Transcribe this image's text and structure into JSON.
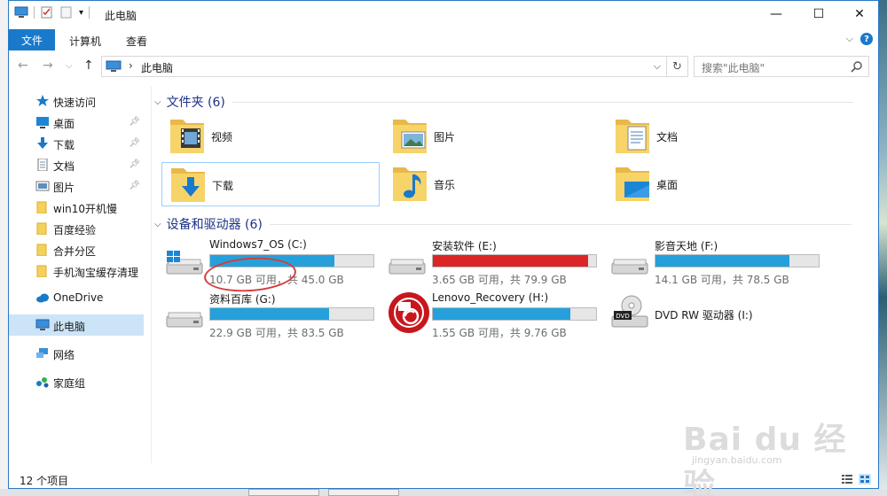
{
  "window": {
    "title": "此电脑",
    "minimize": "—",
    "maximize": "☐",
    "close": "✕"
  },
  "ribbon": {
    "file_tab": "文件",
    "tabs": [
      "计算机",
      "查看"
    ]
  },
  "address": {
    "path": "此电脑",
    "chevron": "›",
    "dropdown": "⌵",
    "refresh": "↻"
  },
  "search": {
    "placeholder": "搜索\"此电脑\""
  },
  "sidebar": {
    "items": [
      {
        "label": "快速访问",
        "icon": "star-icon"
      },
      {
        "label": "桌面",
        "icon": "desktop-icon",
        "pinned": true
      },
      {
        "label": "下载",
        "icon": "download-icon",
        "pinned": true
      },
      {
        "label": "文档",
        "icon": "document-icon",
        "pinned": true
      },
      {
        "label": "图片",
        "icon": "pictures-icon",
        "pinned": true
      },
      {
        "label": "win10开机慢",
        "icon": "folder-icon"
      },
      {
        "label": "百度经验",
        "icon": "folder-icon"
      },
      {
        "label": "合并分区",
        "icon": "folder-icon"
      },
      {
        "label": "手机淘宝缓存清理",
        "icon": "folder-icon"
      },
      {
        "label": "OneDrive",
        "icon": "cloud-icon"
      },
      {
        "label": "此电脑",
        "icon": "computer-icon",
        "active": true
      },
      {
        "label": "网络",
        "icon": "network-icon"
      },
      {
        "label": "家庭组",
        "icon": "homegroup-icon"
      }
    ]
  },
  "folders_group": {
    "title": "文件夹 (6)",
    "items": [
      {
        "label": "视频",
        "icon": "videos-folder-icon"
      },
      {
        "label": "图片",
        "icon": "pictures-folder-icon"
      },
      {
        "label": "文档",
        "icon": "documents-folder-icon"
      },
      {
        "label": "下载",
        "icon": "downloads-folder-icon"
      },
      {
        "label": "音乐",
        "icon": "music-folder-icon"
      },
      {
        "label": "桌面",
        "icon": "desktop-folder-icon"
      }
    ]
  },
  "drives_group": {
    "title": "设备和驱动器 (6)",
    "items": [
      {
        "name": "Windows7_OS (C:)",
        "free": "10.7 GB 可用，共 45.0 GB",
        "used_fraction": 0.76,
        "alert": false,
        "icon": "windows-drive-icon"
      },
      {
        "name": "安装软件 (E:)",
        "free": "3.65 GB 可用，共 79.9 GB",
        "used_fraction": 0.95,
        "alert": true,
        "icon": "hard-drive-icon"
      },
      {
        "name": "影音天地 (F:)",
        "free": "14.1 GB 可用，共 78.5 GB",
        "used_fraction": 0.82,
        "alert": false,
        "icon": "hard-drive-icon"
      },
      {
        "name": "资料百库 (G:)",
        "free": "22.9 GB 可用，共 83.5 GB",
        "used_fraction": 0.73,
        "alert": false,
        "icon": "hard-drive-icon"
      },
      {
        "name": "Lenovo_Recovery (H:)",
        "free": "1.55 GB 可用，共 9.76 GB",
        "used_fraction": 0.84,
        "alert": false,
        "icon": "lenovo-recovery-icon"
      },
      {
        "name": "DVD RW 驱动器 (I:)",
        "icon": "dvd-drive-icon"
      }
    ]
  },
  "status": {
    "count": "12 个项目"
  },
  "watermark": {
    "brand": "Bai du 经验",
    "url": "jingyan.baidu.com"
  },
  "colors": {
    "accent": "#1979ca",
    "bar_normal": "#26a0da",
    "bar_alert": "#da2626",
    "annotation": "#d83b3b"
  }
}
